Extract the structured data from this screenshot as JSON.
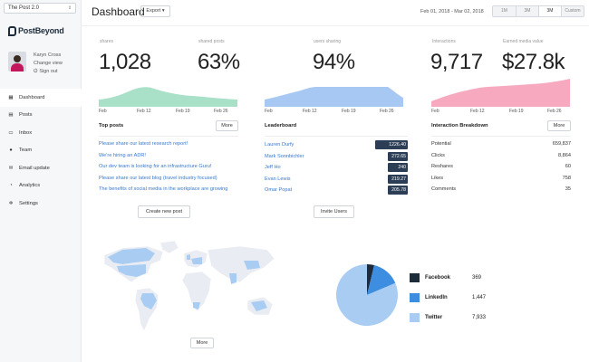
{
  "sidebar": {
    "org_select": "The Post 2.0",
    "brand": "PostBeyond",
    "user": {
      "name": "Karyn Cross",
      "change_view": "Change view",
      "sign_out": "Sign out"
    },
    "nav": [
      {
        "label": "Dashboard",
        "icon": "dashboard-icon",
        "glyph": "▦",
        "active": true
      },
      {
        "label": "Posts",
        "icon": "posts-icon",
        "glyph": "▤"
      },
      {
        "label": "Inbox",
        "icon": "inbox-icon",
        "glyph": "▭"
      },
      {
        "label": "Team",
        "icon": "team-icon",
        "glyph": "●"
      },
      {
        "label": "Email update",
        "icon": "email-icon",
        "glyph": "✉"
      },
      {
        "label": "Analytics",
        "icon": "analytics-icon",
        "glyph": "◔"
      },
      {
        "label": "Settings",
        "icon": "settings-icon",
        "glyph": "✲"
      }
    ]
  },
  "header": {
    "title": "Dashboard",
    "export_label": "Export ▾",
    "date_range": "Feb 01, 2018 - Mar 02, 2018",
    "ranges": [
      {
        "label": "1M"
      },
      {
        "label": "3M"
      },
      {
        "label": "3M"
      },
      {
        "label": "Custom"
      }
    ]
  },
  "stats": {
    "shares": {
      "label": "shares",
      "value": "1,028"
    },
    "shared_posts": {
      "label": "shared posts",
      "value": "63%"
    },
    "users_sharing": {
      "label": "users sharing",
      "value": "94%"
    },
    "interactions": {
      "label": "Interactions",
      "value": "9,717"
    },
    "earned_media": {
      "label": "Earned media value",
      "value": "$27.8k"
    }
  },
  "sparklines": {
    "ticks": [
      "Feb",
      "Feb 12",
      "Feb 19",
      "Feb 26"
    ],
    "shares_color": "#9bdcc0",
    "users_color": "#9cc3f0",
    "interactions_color": "#f6a3bb"
  },
  "top_posts": {
    "title": "Top posts",
    "more_label": "More",
    "items": [
      "Please share our latest research report!",
      "We're hiring an ADR!",
      "Our dev team is looking for an infrastructure Guru!",
      "Please share our latest blog (travel industry focused)",
      "The benefits of social media in the workplace are growing"
    ],
    "create_label": "Create new post"
  },
  "leaderboard": {
    "title": "Leaderboard",
    "rows": [
      {
        "name": "Lauren Durfy",
        "score": "1226.40",
        "fraction": 1.0
      },
      {
        "name": "Mark Sonnbichler",
        "score": "272.65",
        "fraction": 0.22
      },
      {
        "name": "Jeff Ho",
        "score": "240",
        "fraction": 0.2
      },
      {
        "name": "Evan Lewis",
        "score": "219.27",
        "fraction": 0.18
      },
      {
        "name": "Omar Popat",
        "score": "205.78",
        "fraction": 0.17
      }
    ],
    "invite_label": "Invite Users"
  },
  "interaction_breakdown": {
    "title": "Interaction Breakdown",
    "more_label": "More",
    "rows": [
      {
        "label": "Potential",
        "value": "659,837"
      },
      {
        "label": "Clicks",
        "value": "8,864"
      },
      {
        "label": "Reshares",
        "value": "60"
      },
      {
        "label": "Likes",
        "value": "758"
      },
      {
        "label": "Comments",
        "value": "35"
      }
    ]
  },
  "map": {
    "more_label": "More"
  },
  "social": {
    "rows": [
      {
        "name": "Facebook",
        "value": "369",
        "count": 369,
        "color": "#1d2b3a"
      },
      {
        "name": "LinkedIn",
        "value": "1,447",
        "count": 1447,
        "color": "#3d8ee0"
      },
      {
        "name": "Twitter",
        "value": "7,933",
        "count": 7933,
        "color": "#a9ccf2"
      }
    ]
  }
}
